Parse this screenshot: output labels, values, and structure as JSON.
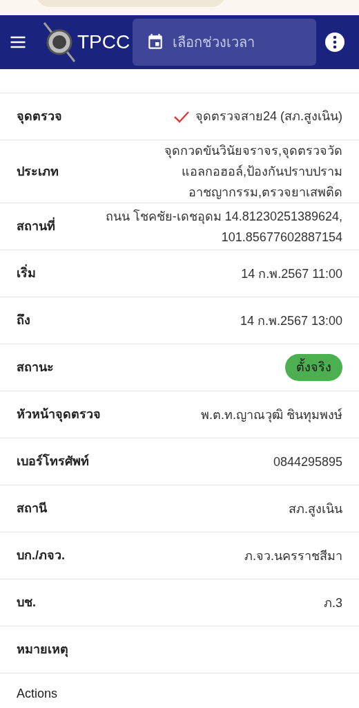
{
  "app_bar": {
    "title": "TPCC",
    "date_range": {
      "placeholder": "เลือกช่วงเวลา"
    }
  },
  "details": [
    {
      "kind": "checked",
      "label": "จุดตรวจ",
      "value": "จุดตรวจสาย24 (สภ.สูงเนิน)"
    },
    {
      "kind": "text",
      "label": "ประเภท",
      "value": "จุดกวดขันวินัยจราจร,จุดตรวจวัดแอลกอฮอล์,ป้องกันปราบปรามอาชญากรรม,ตรวจยาเสพติด"
    },
    {
      "kind": "text",
      "label": "สถานที่",
      "value": "ถนน โชคชัย-เดชอุดม 14.81230251389624, 101.85677602887154"
    },
    {
      "kind": "text",
      "label": "เริ่ม",
      "value": "14 ก.พ.2567 11:00"
    },
    {
      "kind": "text",
      "label": "ถึง",
      "value": "14 ก.พ.2567 13:00"
    },
    {
      "kind": "status",
      "label": "สถานะ",
      "value": "ตั้งจริง",
      "color": "#4caf50"
    },
    {
      "kind": "text",
      "label": "หัวหน้าจุดตรวจ",
      "value": "พ.ต.ท.ญาณวุฒิ ชินทุมพงษ์"
    },
    {
      "kind": "text",
      "label": "เบอร์โทรศัพท์",
      "value": "0844295895"
    },
    {
      "kind": "text",
      "label": "สถานี",
      "value": "สภ.สูงเนิน"
    },
    {
      "kind": "text",
      "label": "บก./ภจว.",
      "value": "ภ.จว.นครราชสีมา"
    },
    {
      "kind": "text",
      "label": "บช.",
      "value": "ภ.3"
    },
    {
      "kind": "text",
      "label": "หมายเหตุ"
    }
  ],
  "actions": {
    "label": "Actions"
  }
}
